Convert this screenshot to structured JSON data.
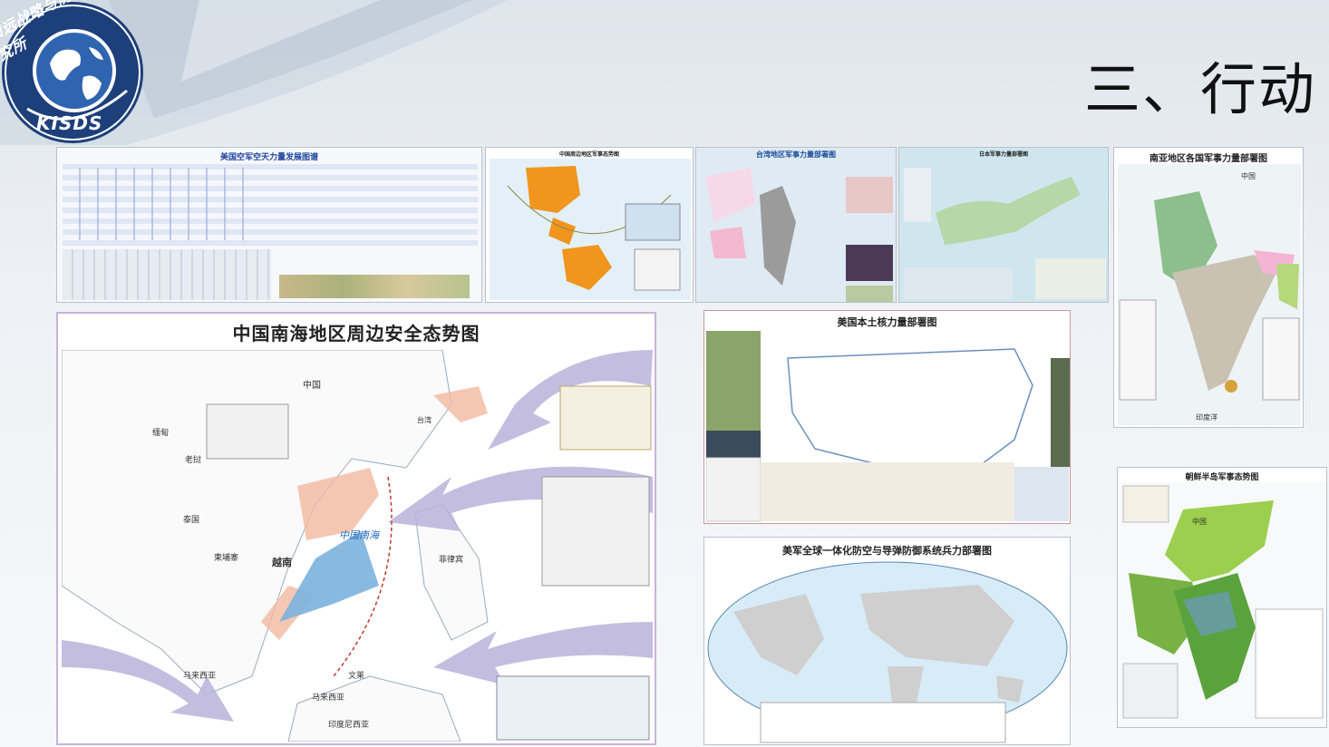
{
  "slide": {
    "title": "三、行动",
    "logo": {
      "arc_text": "知远战略与防务研究所",
      "abbr": "KISDS"
    }
  },
  "maps": [
    {
      "id": "us-af",
      "title": "美国空军空天力量发展图谱"
    },
    {
      "id": "china-periphery",
      "title": "中国周边地区军事态势图"
    },
    {
      "id": "taiwan",
      "title": "台湾地区军事力量部署图"
    },
    {
      "id": "japan",
      "title": "日本军事力量部署图"
    },
    {
      "id": "south-asia",
      "title": "南亚地区各国军事力量部署图",
      "labels": {
        "china": "中国",
        "ocean": "印度洋"
      }
    },
    {
      "id": "scs",
      "title": "中国南海地区周边安全态势图",
      "labels": {
        "china": "中国",
        "scs": "中国南海",
        "myanmar": "缅甸",
        "laos": "老挝",
        "thailand": "泰国",
        "cambodia": "柬埔寨",
        "vietnam": "越南",
        "philippines": "菲律宾",
        "malaysia": "马来西亚",
        "brunei": "文莱",
        "indonesia": "印度尼西亚",
        "taiwan": "台湾"
      }
    },
    {
      "id": "us-nuclear",
      "title": "美国本土核力量部署图"
    },
    {
      "id": "us-ad",
      "title": "美军全球一体化防空与导弹防御系统兵力部署图"
    },
    {
      "id": "korea",
      "title": "朝鲜半岛军事态势图",
      "labels": {
        "china": "中国"
      }
    }
  ]
}
